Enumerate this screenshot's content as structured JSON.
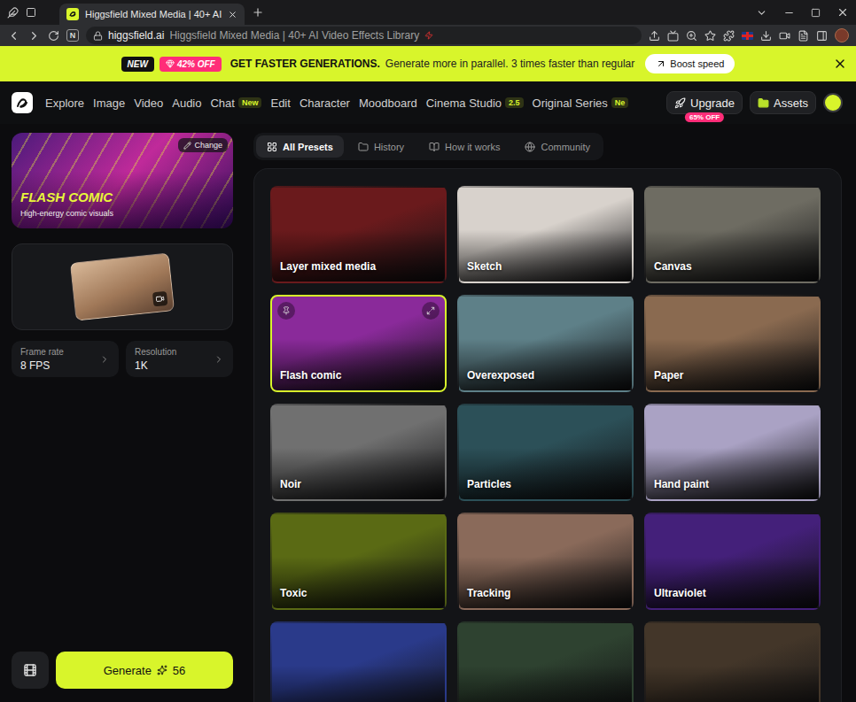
{
  "browser": {
    "tab_title": "Higgsfield Mixed Media | 40+ AI",
    "extension_badge": "N",
    "url_host": "higgsfield.ai",
    "url_title": "Higgsfield Mixed Media | 40+ AI Video Effects Library"
  },
  "promo": {
    "new_badge": "NEW",
    "discount": "42% OFF",
    "headline": "GET FASTER GENERATIONS.",
    "text": "Generate more in parallel. 3 times faster than regular",
    "button": "Boost speed"
  },
  "nav": {
    "items": [
      {
        "label": "Explore"
      },
      {
        "label": "Image"
      },
      {
        "label": "Video"
      },
      {
        "label": "Audio"
      },
      {
        "label": "Chat",
        "badge": "New"
      },
      {
        "label": "Edit"
      },
      {
        "label": "Character"
      },
      {
        "label": "Moodboard"
      },
      {
        "label": "Cinema Studio",
        "badge": "2.5"
      },
      {
        "label": "Original Series",
        "badge": "Ne"
      }
    ],
    "upgrade": {
      "label": "Upgrade",
      "badge": "65% OFF"
    },
    "assets": "Assets"
  },
  "preset": {
    "title": "FLASH COMIC",
    "subtitle": "High-energy comic visuals",
    "change": "Change"
  },
  "settings": [
    {
      "label": "Frame rate",
      "value": "8 FPS"
    },
    {
      "label": "Resolution",
      "value": "1K"
    }
  ],
  "generate": {
    "label": "Generate",
    "cost": "56"
  },
  "tabs": [
    {
      "label": "All Presets",
      "selected": true
    },
    {
      "label": "History",
      "selected": false
    },
    {
      "label": "How it works",
      "selected": false
    },
    {
      "label": "Community",
      "selected": false
    }
  ],
  "presets": [
    {
      "label": "Layer mixed media",
      "selected": false,
      "color": "#6a1a1c"
    },
    {
      "label": "Sketch",
      "selected": false,
      "color": "#d8d2cc"
    },
    {
      "label": "Canvas",
      "selected": false,
      "color": "#6e6c62"
    },
    {
      "label": "Flash comic",
      "selected": true,
      "color": "#8a2a9a"
    },
    {
      "label": "Overexposed",
      "selected": false,
      "color": "#5e8088"
    },
    {
      "label": "Paper",
      "selected": false,
      "color": "#8a6a50"
    },
    {
      "label": "Noir",
      "selected": false,
      "color": "#707070"
    },
    {
      "label": "Particles",
      "selected": false,
      "color": "#2c5058"
    },
    {
      "label": "Hand paint",
      "selected": false,
      "color": "#aaa2c4"
    },
    {
      "label": "Toxic",
      "selected": false,
      "color": "#5a6a14"
    },
    {
      "label": "Tracking",
      "selected": false,
      "color": "#8a6a5a"
    },
    {
      "label": "Ultraviolet",
      "selected": false,
      "color": "#44207a"
    },
    {
      "selected": false,
      "color": "#2a3a8a"
    },
    {
      "selected": false,
      "color": "#2e4230"
    },
    {
      "selected": false,
      "color": "#433629"
    }
  ]
}
